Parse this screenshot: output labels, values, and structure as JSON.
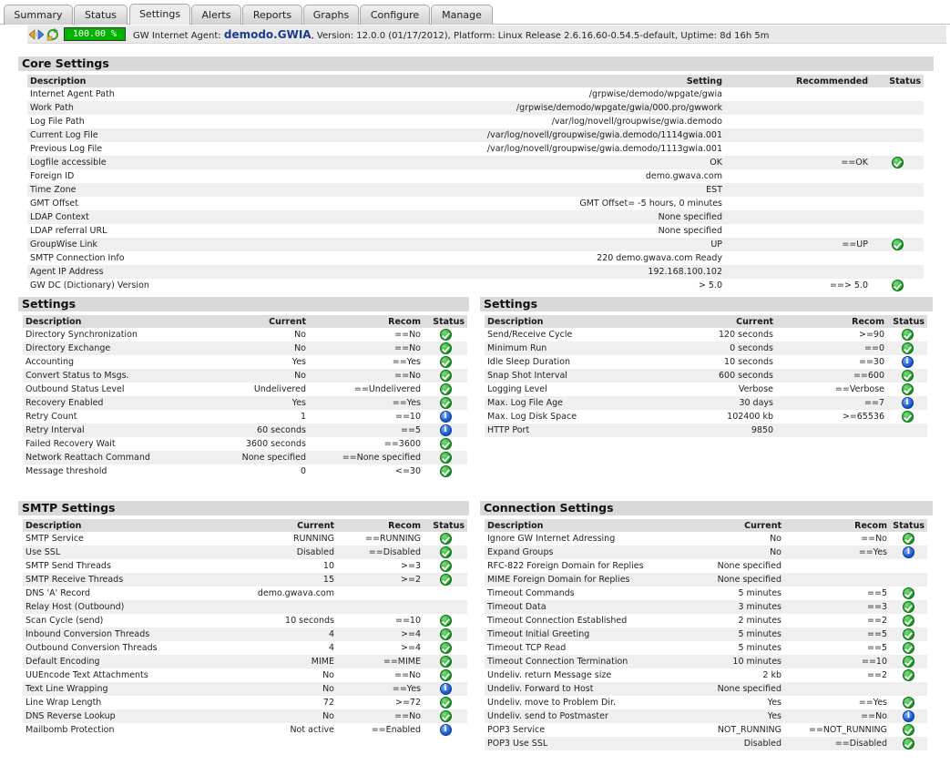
{
  "tabs": [
    {
      "label": "Summary"
    },
    {
      "label": "Status"
    },
    {
      "label": "Settings"
    },
    {
      "label": "Alerts"
    },
    {
      "label": "Reports"
    },
    {
      "label": "Graphs"
    },
    {
      "label": "Configure"
    },
    {
      "label": "Manage"
    }
  ],
  "active_tab": "Settings",
  "infobar": {
    "uptime_meter": "100.00 %",
    "prefix": "GW Internet Agent: ",
    "agent_name": "demodo.GWIA",
    "details": ", Version: 12.0.0 (01/17/2012), Platform: Linux Release 2.6.16.60-0.54.5-default, Uptime: 8d 16h 5m"
  },
  "core_settings": {
    "title": "Core Settings",
    "headers": {
      "description": "Description",
      "setting": "Setting",
      "recommended": "Recommended",
      "status": "Status"
    },
    "rows": [
      {
        "description": "Internet Agent Path",
        "setting": "/grpwise/demodo/wpgate/gwia",
        "recommended": "",
        "status": ""
      },
      {
        "description": "Work Path",
        "setting": "/grpwise/demodo/wpgate/gwia/000.pro/gwwork",
        "recommended": "",
        "status": ""
      },
      {
        "description": "Log File Path",
        "setting": "/var/log/novell/groupwise/gwia.demodo",
        "recommended": "",
        "status": ""
      },
      {
        "description": "Current Log File",
        "setting": "/var/log/novell/groupwise/gwia.demodo/1114gwia.001",
        "recommended": "",
        "status": ""
      },
      {
        "description": "Previous Log File",
        "setting": "/var/log/novell/groupwise/gwia.demodo/1113gwia.001",
        "recommended": "",
        "status": ""
      },
      {
        "description": "Logfile accessible",
        "setting": "OK",
        "recommended": "==OK",
        "status": "ok"
      },
      {
        "description": "Foreign ID",
        "setting": "demo.gwava.com",
        "recommended": "",
        "status": ""
      },
      {
        "description": "Time Zone",
        "setting": "EST",
        "recommended": "",
        "status": ""
      },
      {
        "description": "GMT Offset",
        "setting": "GMT Offset= -5 hours, 0 minutes",
        "recommended": "",
        "status": ""
      },
      {
        "description": "LDAP Context",
        "setting": "None specified",
        "recommended": "",
        "status": ""
      },
      {
        "description": "LDAP referral URL",
        "setting": "None specified",
        "recommended": "",
        "status": ""
      },
      {
        "description": "GroupWise Link",
        "setting": "UP",
        "recommended": "==UP",
        "status": "ok"
      },
      {
        "description": "SMTP Connection Info",
        "setting": "220 demo.gwava.com Ready",
        "recommended": "",
        "status": ""
      },
      {
        "description": "Agent IP Address",
        "setting": "192.168.100.102",
        "recommended": "",
        "status": ""
      },
      {
        "description": "GW DC (Dictionary) Version",
        "setting": "> 5.0",
        "recommended": "==> 5.0",
        "status": "ok"
      }
    ]
  },
  "settings_left": {
    "title": "Settings",
    "headers": {
      "description": "Description",
      "current": "Current",
      "recom": "Recom",
      "status": "Status"
    },
    "rows": [
      {
        "description": "Directory Synchronization",
        "current": "No",
        "recom": "==No",
        "status": "ok"
      },
      {
        "description": "Directory Exchange",
        "current": "No",
        "recom": "==No",
        "status": "ok"
      },
      {
        "description": "Accounting",
        "current": "Yes",
        "recom": "==Yes",
        "status": "ok"
      },
      {
        "description": "Convert Status to Msgs.",
        "current": "No",
        "recom": "==No",
        "status": "ok"
      },
      {
        "description": "Outbound Status Level",
        "current": "Undelivered",
        "recom": "==Undelivered",
        "status": "ok"
      },
      {
        "description": "Recovery Enabled",
        "current": "Yes",
        "recom": "==Yes",
        "status": "ok"
      },
      {
        "description": "Retry Count",
        "current": "1",
        "recom": "==10",
        "status": "info"
      },
      {
        "description": "Retry Interval",
        "current": "60 seconds",
        "recom": "==5",
        "status": "info"
      },
      {
        "description": "Failed Recovery Wait",
        "current": "3600 seconds",
        "recom": "==3600",
        "status": "ok"
      },
      {
        "description": "Network Reattach Command",
        "current": "None specified",
        "recom": "==None specified",
        "status": "ok"
      },
      {
        "description": "Message threshold",
        "current": "0",
        "recom": "<=30",
        "status": "ok"
      }
    ]
  },
  "settings_right": {
    "title": "Settings",
    "headers": {
      "description": "Description",
      "current": "Current",
      "recom": "Recom",
      "status": "Status"
    },
    "rows": [
      {
        "description": "Send/Receive Cycle",
        "current": "120 seconds",
        "recom": ">=90",
        "status": "ok"
      },
      {
        "description": "Minimum Run",
        "current": "0 seconds",
        "recom": "==0",
        "status": "ok"
      },
      {
        "description": "Idle Sleep Duration",
        "current": "10 seconds",
        "recom": "==30",
        "status": "info"
      },
      {
        "description": "Snap Shot Interval",
        "current": "600 seconds",
        "recom": "==600",
        "status": "ok"
      },
      {
        "description": "Logging Level",
        "current": "Verbose",
        "recom": "==Verbose",
        "status": "ok"
      },
      {
        "description": "Max. Log File Age",
        "current": "30 days",
        "recom": "==7",
        "status": "info"
      },
      {
        "description": "Max. Log Disk Space",
        "current": "102400 kb",
        "recom": ">=65536",
        "status": "ok"
      },
      {
        "description": "HTTP Port",
        "current": "9850",
        "recom": "",
        "status": ""
      }
    ]
  },
  "smtp_settings": {
    "title": "SMTP Settings",
    "headers": {
      "description": "Description",
      "current": "Current",
      "recom": "Recom",
      "status": "Status"
    },
    "rows": [
      {
        "description": "SMTP Service",
        "current": "RUNNING",
        "recom": "==RUNNING",
        "status": "ok"
      },
      {
        "description": "Use SSL",
        "current": "Disabled",
        "recom": "==Disabled",
        "status": "ok"
      },
      {
        "description": "SMTP Send Threads",
        "current": "10",
        "recom": ">=3",
        "status": "ok"
      },
      {
        "description": "SMTP Receive Threads",
        "current": "15",
        "recom": ">=2",
        "status": "ok"
      },
      {
        "description": "DNS 'A' Record",
        "current": "demo.gwava.com",
        "recom": "",
        "status": ""
      },
      {
        "description": "Relay Host (Outbound)",
        "current": "",
        "recom": "",
        "status": ""
      },
      {
        "description": "Scan Cycle (send)",
        "current": "10 seconds",
        "recom": "==10",
        "status": "ok"
      },
      {
        "description": "Inbound Conversion Threads",
        "current": "4",
        "recom": ">=4",
        "status": "ok"
      },
      {
        "description": "Outbound Conversion Threads",
        "current": "4",
        "recom": ">=4",
        "status": "ok"
      },
      {
        "description": "Default Encoding",
        "current": "MIME",
        "recom": "==MIME",
        "status": "ok"
      },
      {
        "description": "UUEncode Text Attachments",
        "current": "No",
        "recom": "==No",
        "status": "ok"
      },
      {
        "description": "Text Line Wrapping",
        "current": "No",
        "recom": "==Yes",
        "status": "info"
      },
      {
        "description": "Line Wrap Length",
        "current": "72",
        "recom": ">=72",
        "status": "ok"
      },
      {
        "description": "DNS Reverse Lookup",
        "current": "No",
        "recom": "==No",
        "status": "ok"
      },
      {
        "description": "Mailbomb Protection",
        "current": "Not active",
        "recom": "==Enabled",
        "status": "info"
      }
    ]
  },
  "connection_settings": {
    "title": "Connection Settings",
    "headers": {
      "description": "Description",
      "current": "Current",
      "recom": "Recom",
      "status": "Status"
    },
    "rows": [
      {
        "description": "Ignore GW Internet Adressing",
        "current": "No",
        "recom": "==No",
        "status": "ok"
      },
      {
        "description": "Expand Groups",
        "current": "No",
        "recom": "==Yes",
        "status": "info"
      },
      {
        "description": "RFC-822 Foreign Domain for Replies",
        "current": "None specified",
        "recom": "",
        "status": ""
      },
      {
        "description": "MIME Foreign Domain for Replies",
        "current": "None specified",
        "recom": "",
        "status": ""
      },
      {
        "description": "Timeout Commands",
        "current": "5 minutes",
        "recom": "==5",
        "status": "ok"
      },
      {
        "description": "Timeout Data",
        "current": "3 minutes",
        "recom": "==3",
        "status": "ok"
      },
      {
        "description": "Timeout Connection Established",
        "current": "2 minutes",
        "recom": "==2",
        "status": "ok"
      },
      {
        "description": "Timeout Initial Greeting",
        "current": "5 minutes",
        "recom": "==5",
        "status": "ok"
      },
      {
        "description": "Timeout TCP Read",
        "current": "5 minutes",
        "recom": "==5",
        "status": "ok"
      },
      {
        "description": "Timeout Connection Termination",
        "current": "10 minutes",
        "recom": "==10",
        "status": "ok"
      },
      {
        "description": "Undeliv. return Message size",
        "current": "2 kb",
        "recom": "==2",
        "status": "ok"
      },
      {
        "description": "Undeliv. Forward to Host",
        "current": "None specified",
        "recom": "",
        "status": ""
      },
      {
        "description": "Undeliv. move to Problem Dir.",
        "current": "Yes",
        "recom": "==Yes",
        "status": "ok"
      },
      {
        "description": "Undeliv. send to Postmaster",
        "current": "Yes",
        "recom": "==No",
        "status": "info"
      },
      {
        "description": "POP3 Service",
        "current": "NOT_RUNNING",
        "recom": "==NOT_RUNNING",
        "status": "ok"
      },
      {
        "description": "POP3 Use SSL",
        "current": "Disabled",
        "recom": "==Disabled",
        "status": "ok"
      }
    ]
  }
}
